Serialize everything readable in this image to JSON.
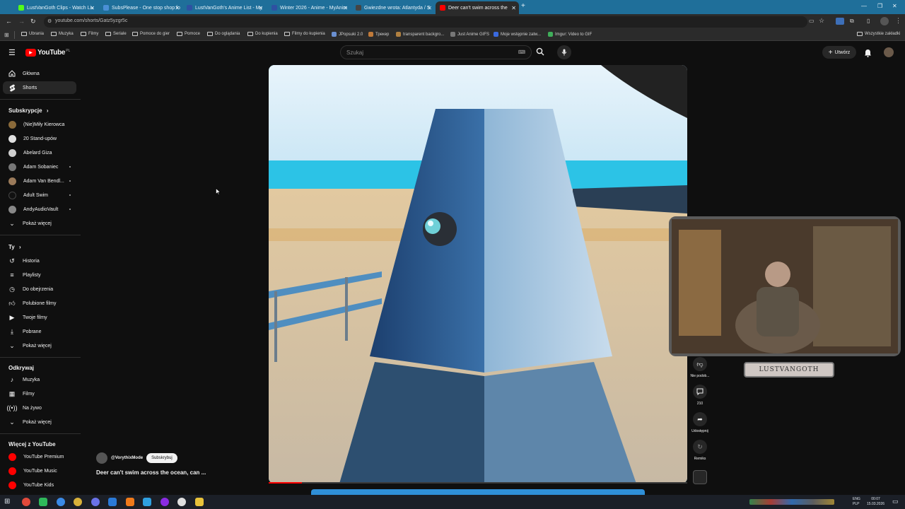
{
  "browser": {
    "tabs": [
      {
        "label": "LustVanGoth Clips - Watch Liv",
        "color": "#53fc18"
      },
      {
        "label": "SubsPlease - One stop shop fo",
        "color": "#4a8fd6"
      },
      {
        "label": "LustVanGoth's Anime List - My",
        "color": "#2e51a2"
      },
      {
        "label": "Winter 2026 - Anime - MyAnim",
        "color": "#2e51a2"
      },
      {
        "label": "Gwiezdne wrota: Atlantyda / S",
        "color": "#444444"
      },
      {
        "label": "Deer can't swim across the",
        "color": "#ff0000"
      }
    ],
    "url": "youtube.com/shorts/Gatz5yzgr5c",
    "bookmarks": [
      {
        "label": "Ubrania",
        "icon": "folder"
      },
      {
        "label": "Muzyka",
        "icon": "folder"
      },
      {
        "label": "Filmy",
        "icon": "folder"
      },
      {
        "label": "Seriale",
        "icon": "folder"
      },
      {
        "label": "Pomoce do gier",
        "icon": "folder"
      },
      {
        "label": "Pomoce",
        "icon": "folder"
      },
      {
        "label": "Do oglądania",
        "icon": "folder"
      },
      {
        "label": "Do kupienia",
        "icon": "folder"
      },
      {
        "label": "Filmy do kupienia",
        "icon": "folder"
      },
      {
        "label": "JPopsuki 2.0",
        "icon": "site"
      },
      {
        "label": "Трекер",
        "icon": "site"
      },
      {
        "label": "transparent backgro...",
        "icon": "site"
      },
      {
        "label": "Just Anime GIFS",
        "icon": "site"
      },
      {
        "label": "Moje wstępnie zatw...",
        "icon": "site"
      },
      {
        "label": "Imgur: Video to GIF",
        "icon": "site"
      }
    ],
    "all_bookmarks": "Wszystkie zakładki"
  },
  "youtube": {
    "logo": "YouTube",
    "country": "PL",
    "search_placeholder": "Szukaj",
    "create_label": "Utwórz",
    "nav": [
      {
        "label": "Główna",
        "icon": "home-icon"
      },
      {
        "label": "Shorts",
        "icon": "shorts-icon",
        "active": true
      }
    ],
    "subscriptions_header": "Subskrypcje",
    "subscriptions": [
      {
        "label": "(Nie)Miły Kierowca",
        "avatar": "#8a6a3a"
      },
      {
        "label": "20 Stand-upów",
        "avatar": "#e0e0e0"
      },
      {
        "label": "Abelard Giza",
        "avatar": "#cfcfcf"
      },
      {
        "label": "Adam Sobaniec",
        "avatar": "#777777",
        "dot": true
      },
      {
        "label": "Adam Van Bendl...",
        "avatar": "#9a7a5a",
        "dot": true
      },
      {
        "label": "Adult Swim",
        "avatar": "#111111",
        "dot": true
      },
      {
        "label": "AndyAudioVault",
        "avatar": "#888888",
        "dot": true
      }
    ],
    "show_more": "Pokaż więcej",
    "you_header": "Ty",
    "you_items": [
      {
        "label": "Historia",
        "icon": "history-icon"
      },
      {
        "label": "Playlisty",
        "icon": "playlist-icon"
      },
      {
        "label": "Do obejrzenia",
        "icon": "clock-icon"
      },
      {
        "label": "Polubione filmy",
        "icon": "thumbs-up-icon"
      },
      {
        "label": "Twoje filmy",
        "icon": "video-icon"
      },
      {
        "label": "Pobrane",
        "icon": "download-icon"
      }
    ],
    "explore_header": "Odkrywaj",
    "explore_items": [
      {
        "label": "Muzyka",
        "icon": "music-icon"
      },
      {
        "label": "Filmy",
        "icon": "film-icon"
      },
      {
        "label": "Na żywo",
        "icon": "live-icon"
      }
    ],
    "more_header": "Więcej z YouTube",
    "more_items": [
      {
        "label": "YouTube Premium"
      },
      {
        "label": "YouTube Music"
      },
      {
        "label": "YouTube Kids"
      }
    ],
    "short": {
      "channel": "@VorythixMode",
      "subscribe": "Subskrybuj",
      "title": "Deer can't swim across the ocean, can ..."
    },
    "actions": {
      "dislike_label": "Nie podob...",
      "comments_count": "210",
      "share_label": "Udostępnij",
      "remix_label": "Remiks"
    },
    "overlay_text": "LUSTVANGOTH"
  },
  "taskbar": {
    "lang": "ENG",
    "lang2": "PLP",
    "time": "00:07",
    "date": "15.03.2026"
  }
}
